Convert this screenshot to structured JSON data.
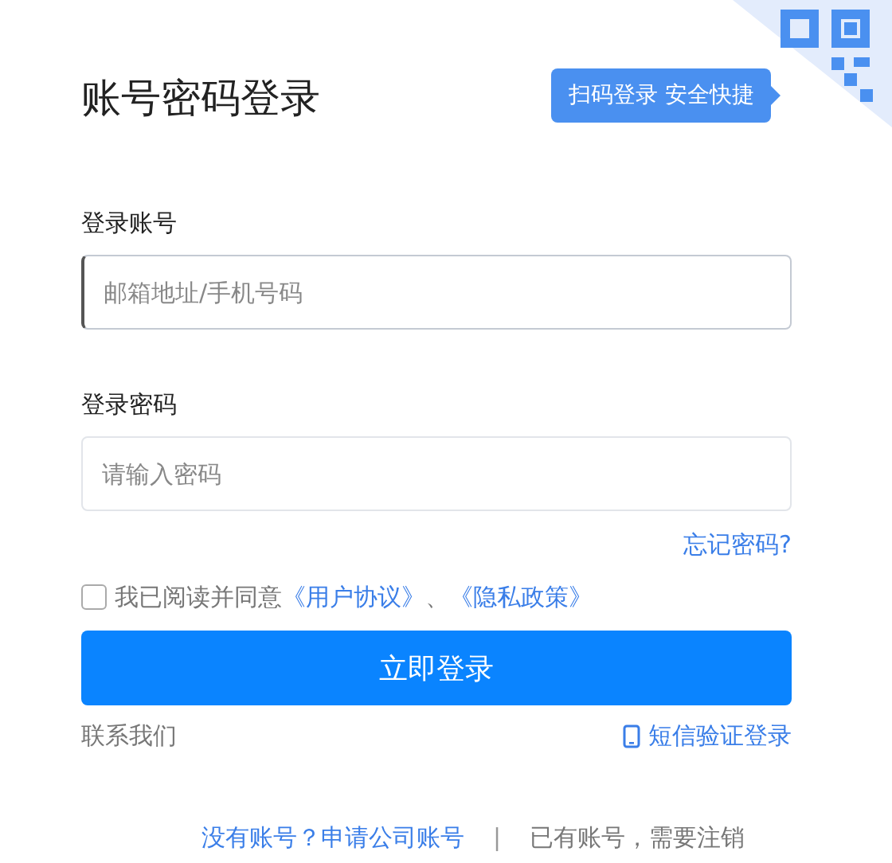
{
  "title": "账号密码登录",
  "qr_tip": "扫码登录 安全快捷",
  "fields": [
    {
      "label": "登录账号",
      "placeholder": "邮箱地址/手机号码",
      "focused": true
    },
    {
      "label": "登录密码",
      "placeholder": "请输入密码",
      "focused": false
    }
  ],
  "forgot_link": "忘记密码?",
  "agreement": {
    "checked": false,
    "text": "我已阅读并同意",
    "links": [
      "《用户协议》",
      "《隐私政策》"
    ],
    "separator": "、"
  },
  "login_button": "立即登录",
  "contact_link": "联系我们",
  "sms_link": "短信验证登录",
  "footer": {
    "left": "没有账号？申请公司账号",
    "divider": "|",
    "right": "已有账号，需要注销"
  }
}
